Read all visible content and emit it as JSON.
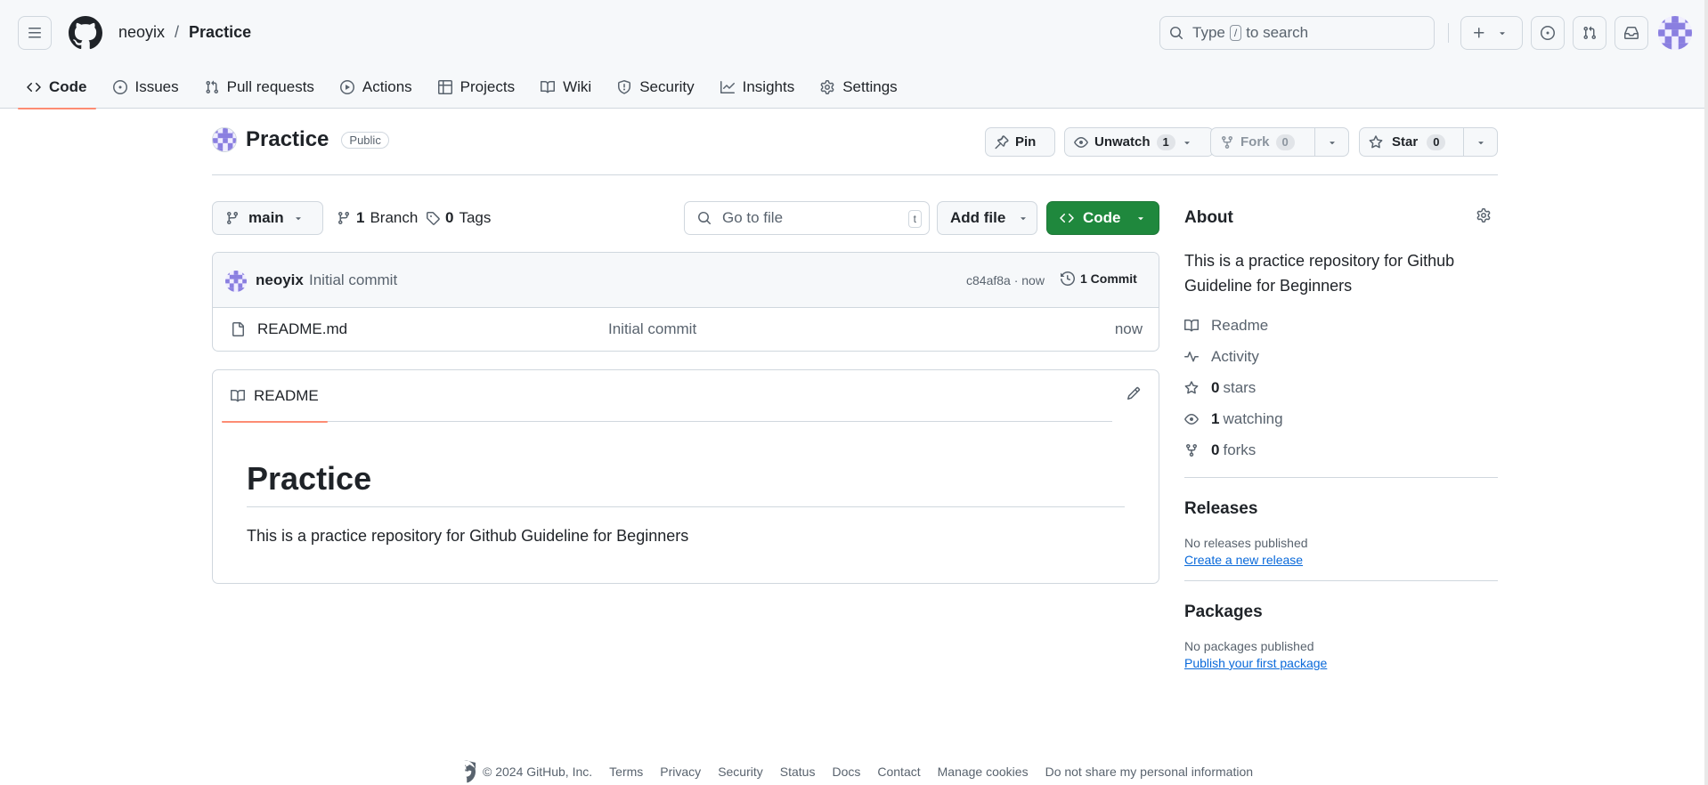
{
  "header": {
    "owner": "neoyix",
    "separator": "/",
    "repo": "Practice",
    "search_prefix": "Type",
    "search_key": "/",
    "search_suffix": "to search"
  },
  "nav_tabs": [
    {
      "label": "Code",
      "icon": "code-icon",
      "active": true
    },
    {
      "label": "Issues",
      "icon": "issue-icon"
    },
    {
      "label": "Pull requests",
      "icon": "pull-request-icon"
    },
    {
      "label": "Actions",
      "icon": "play-icon"
    },
    {
      "label": "Projects",
      "icon": "table-icon"
    },
    {
      "label": "Wiki",
      "icon": "book-icon"
    },
    {
      "label": "Security",
      "icon": "shield-icon"
    },
    {
      "label": "Insights",
      "icon": "graph-icon"
    },
    {
      "label": "Settings",
      "icon": "gear-icon"
    }
  ],
  "repo_header": {
    "name": "Practice",
    "visibility": "Public",
    "pin_label": "Pin",
    "unwatch_label": "Unwatch",
    "watch_count": "1",
    "fork_label": "Fork",
    "fork_count": "0",
    "star_label": "Star",
    "star_count": "0"
  },
  "file_nav": {
    "branch": "main",
    "branch_count": "1",
    "branch_label": "Branch",
    "tag_count": "0",
    "tag_label": "Tags",
    "goto_placeholder": "Go to file",
    "goto_key": "t",
    "add_file_label": "Add file",
    "code_label": "Code"
  },
  "latest_commit": {
    "author": "neoyix",
    "message": "Initial commit",
    "hash_time": "c84af8a · now",
    "commit_count": "1 Commit"
  },
  "files": [
    {
      "name": "README.md",
      "message": "Initial commit",
      "time": "now"
    }
  ],
  "readme": {
    "tab_label": "README",
    "heading": "Practice",
    "body": "This is a practice repository for Github Guideline for Beginners"
  },
  "about": {
    "title": "About",
    "description": "This is a practice repository for Github Guideline for Beginners",
    "items": [
      {
        "icon": "book-icon",
        "count": "",
        "label": "Readme"
      },
      {
        "icon": "pulse-icon",
        "count": "",
        "label": "Activity"
      },
      {
        "icon": "star-icon",
        "count": "0",
        "label": "stars"
      },
      {
        "icon": "eye-icon",
        "count": "1",
        "label": "watching"
      },
      {
        "icon": "fork-icon",
        "count": "0",
        "label": "forks"
      }
    ]
  },
  "releases": {
    "title": "Releases",
    "empty": "No releases published",
    "link": "Create a new release"
  },
  "packages": {
    "title": "Packages",
    "empty": "No packages published",
    "link": "Publish your first package"
  },
  "footer": {
    "copyright": "© 2024 GitHub, Inc.",
    "links": [
      "Terms",
      "Privacy",
      "Security",
      "Status",
      "Docs",
      "Contact",
      "Manage cookies",
      "Do not share my personal information"
    ]
  },
  "colors": {
    "accent_green": "#1f883d",
    "tab_underline": "#fd8c73",
    "link_blue": "#0969da"
  }
}
